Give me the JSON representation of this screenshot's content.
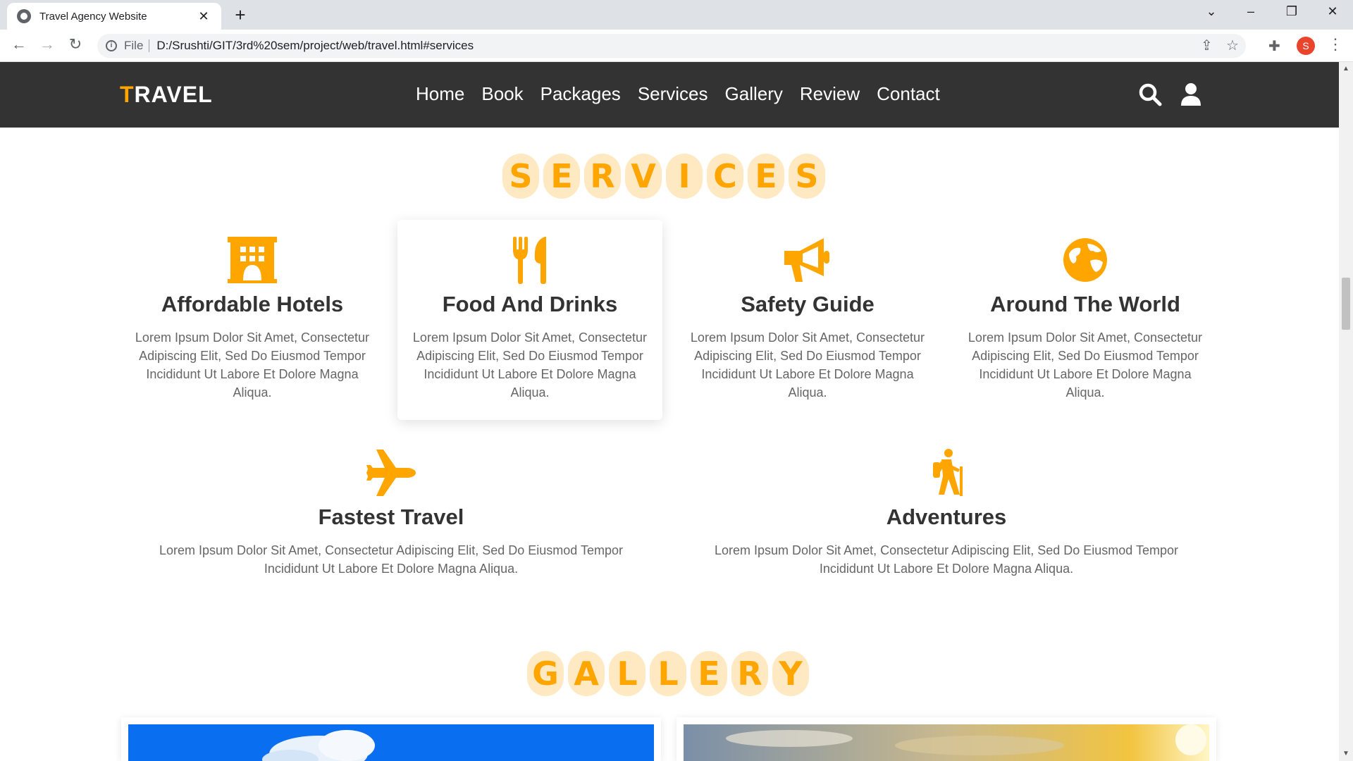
{
  "browser": {
    "tab_title": "Travel Agency Website",
    "address_scheme": "File",
    "address_url": "D:/Srushti/GIT/3rd%20sem/project/web/travel.html#services",
    "profile_initial": "S"
  },
  "site": {
    "logo_first": "T",
    "logo_rest": "RAVEL",
    "nav": [
      "Home",
      "Book",
      "Packages",
      "Services",
      "Gallery",
      "Review",
      "Contact"
    ]
  },
  "services": {
    "title_letters": [
      "S",
      "E",
      "R",
      "V",
      "I",
      "C",
      "E",
      "S"
    ],
    "items": [
      {
        "title": "Affordable Hotels",
        "text": "Lorem Ipsum Dolor Sit Amet, Consectetur Adipiscing Elit, Sed Do Eiusmod Tempor Incididunt Ut Labore Et Dolore Magna Aliqua.",
        "icon": "hotel-icon"
      },
      {
        "title": "Food And Drinks",
        "text": "Lorem Ipsum Dolor Sit Amet, Consectetur Adipiscing Elit, Sed Do Eiusmod Tempor Incididunt Ut Labore Et Dolore Magna Aliqua.",
        "icon": "utensils-icon"
      },
      {
        "title": "Safety Guide",
        "text": "Lorem Ipsum Dolor Sit Amet, Consectetur Adipiscing Elit, Sed Do Eiusmod Tempor Incididunt Ut Labore Et Dolore Magna Aliqua.",
        "icon": "bullhorn-icon"
      },
      {
        "title": "Around The World",
        "text": "Lorem Ipsum Dolor Sit Amet, Consectetur Adipiscing Elit, Sed Do Eiusmod Tempor Incididunt Ut Labore Et Dolore Magna Aliqua.",
        "icon": "globe-icon"
      },
      {
        "title": "Fastest Travel",
        "text": "Lorem Ipsum Dolor Sit Amet, Consectetur Adipiscing Elit, Sed Do Eiusmod Tempor Incididunt Ut Labore Et Dolore Magna Aliqua.",
        "icon": "plane-icon"
      },
      {
        "title": "Adventures",
        "text": "Lorem Ipsum Dolor Sit Amet, Consectetur Adipiscing Elit, Sed Do Eiusmod Tempor Incididunt Ut Labore Et Dolore Magna Aliqua.",
        "icon": "hiking-icon"
      }
    ]
  },
  "gallery": {
    "title_letters": [
      "G",
      "A",
      "L",
      "L",
      "E",
      "R",
      "Y"
    ]
  },
  "colors": {
    "accent": "#ffa500",
    "header_bg": "#333333",
    "letter_bg": "#ffe9c2"
  }
}
